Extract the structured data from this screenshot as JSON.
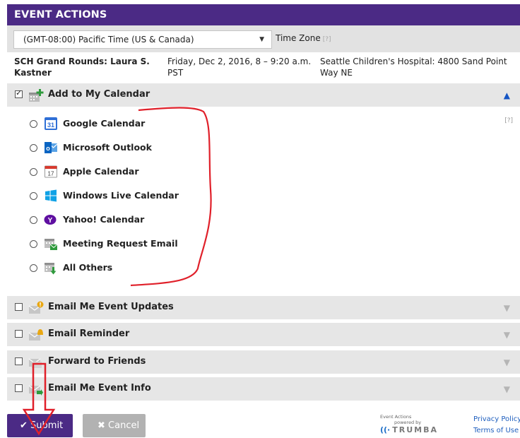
{
  "header": {
    "title": "EVENT ACTIONS"
  },
  "timezone": {
    "selected": "(GMT-08:00) Pacific Time (US & Canada)",
    "label": "Time Zone",
    "help": "[?]"
  },
  "event": {
    "title": "SCH Grand Rounds: Laura S. Kastner",
    "datetime": "Friday, Dec 2, 2016, 8 – 9:20 a.m. PST",
    "location": "Seattle Children's Hospital: 4800 Sand Point Way NE"
  },
  "sections": {
    "add_calendar": {
      "label": "Add to My Calendar",
      "checked": true,
      "help": "[?]"
    },
    "updates": {
      "label": "Email Me Event Updates"
    },
    "reminder": {
      "label": "Email Reminder"
    },
    "forward": {
      "label": "Forward to Friends"
    },
    "info": {
      "label": "Email Me Event Info"
    }
  },
  "calendar_options": [
    {
      "label": "Google Calendar",
      "icon": "google-calendar-icon"
    },
    {
      "label": "Microsoft Outlook",
      "icon": "outlook-icon"
    },
    {
      "label": "Apple Calendar",
      "icon": "apple-calendar-icon"
    },
    {
      "label": "Windows Live Calendar",
      "icon": "windows-icon"
    },
    {
      "label": "Yahoo! Calendar",
      "icon": "yahoo-icon"
    },
    {
      "label": "Meeting Request Email",
      "icon": "meeting-request-icon"
    },
    {
      "label": "All Others",
      "icon": "download-calendar-icon"
    }
  ],
  "buttons": {
    "submit": "Submit",
    "cancel": "Cancel"
  },
  "branding": {
    "line1": "Event Actions",
    "line2": "powered by",
    "logo": "TRUMBA"
  },
  "links": {
    "privacy": "Privacy Policy",
    "terms": "Terms of Use"
  },
  "colors": {
    "header_bg": "#4b2a85",
    "section_bg": "#e6e6e6",
    "annotation": "#e0202a",
    "link": "#1f5fbe"
  }
}
